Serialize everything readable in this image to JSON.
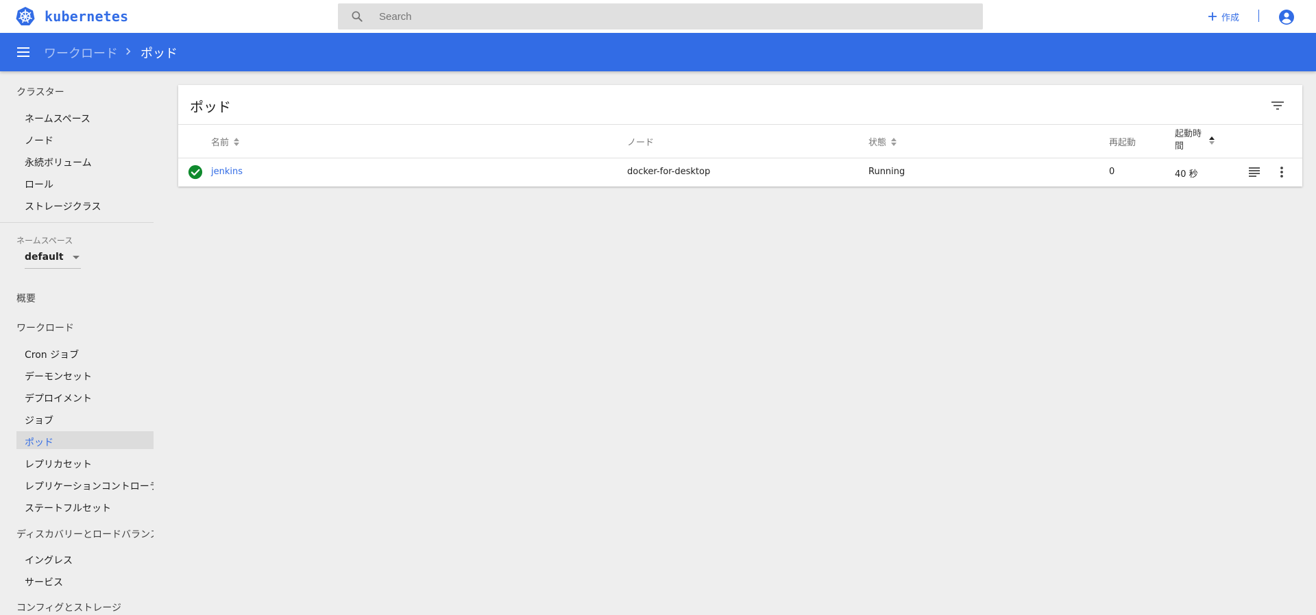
{
  "app": {
    "brand": "kubernetes",
    "colors": {
      "brand": "#326ce5",
      "toolbar": "#326ce5",
      "background": "#eeeeee",
      "success": "#0f8a2d"
    }
  },
  "search": {
    "placeholder": "Search",
    "value": ""
  },
  "header": {
    "create_label": "作成",
    "icons": [
      "kubernetes-logo",
      "search-icon",
      "plus-icon",
      "account-circle-icon"
    ]
  },
  "toolbar": {
    "breadcrumb_parent": "ワークロード",
    "breadcrumb_current": "ポッド",
    "icons": [
      "menu-icon",
      "chevron-right-icon"
    ]
  },
  "sidebar": {
    "cluster": {
      "heading": "クラスター",
      "items": [
        "ネームスペース",
        "ノード",
        "永続ボリューム",
        "ロール",
        "ストレージクラス"
      ]
    },
    "namespace": {
      "label": "ネームスペース",
      "selected": "default"
    },
    "overview": "概要",
    "workloads": {
      "heading": "ワークロード",
      "items": [
        "Cron ジョブ",
        "デーモンセット",
        "デプロイメント",
        "ジョブ",
        "ポッド",
        "レプリカセット",
        "レプリケーションコントローラー",
        "ステートフルセット"
      ],
      "active": "ポッド"
    },
    "discovery": {
      "heading": "ディスカバリーとロードバランス",
      "items": [
        "イングレス",
        "サービス"
      ]
    },
    "config": {
      "heading": "コンフィグとストレージ"
    }
  },
  "pods": {
    "title": "ポッド",
    "columns": {
      "name": "名前",
      "node": "ノード",
      "status": "状態",
      "restarts": "再起動",
      "age_line1": "起動時",
      "age_line2": "間"
    },
    "rows": [
      {
        "status_icon": "check-circle-icon",
        "name": "jenkins",
        "node": "docker-for-desktop",
        "status": "Running",
        "restarts": "0",
        "age": "40 秒"
      }
    ],
    "row_icons": [
      "logs-icon",
      "more-vert-icon"
    ]
  }
}
